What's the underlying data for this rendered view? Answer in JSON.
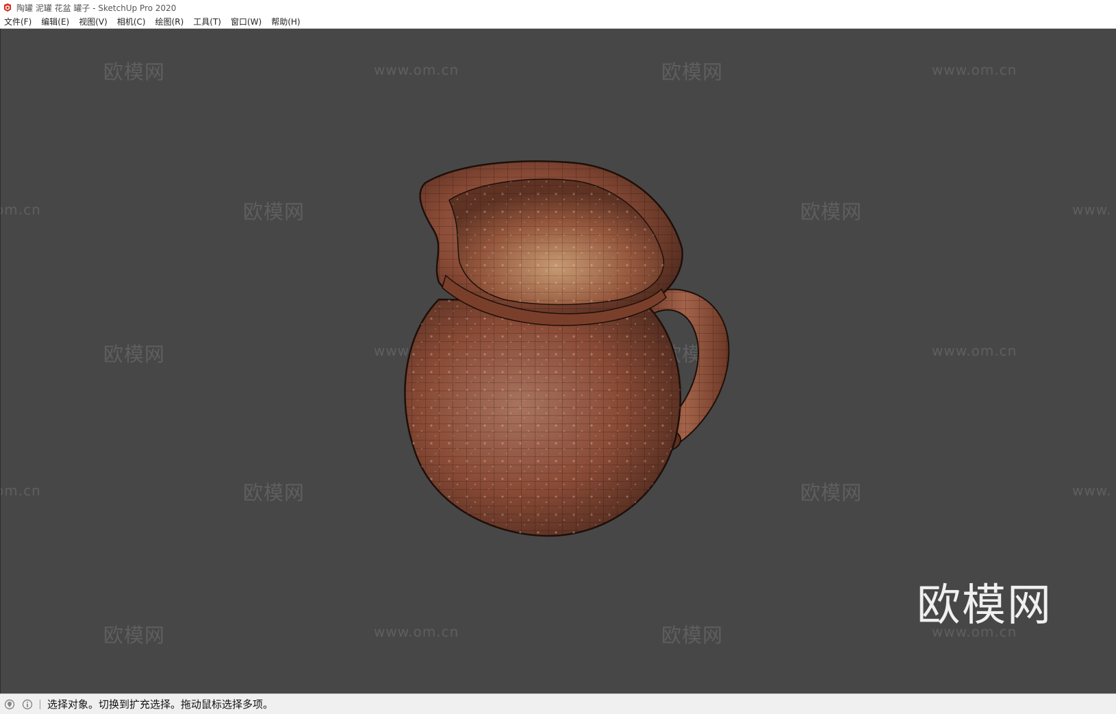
{
  "window": {
    "title": "陶罐 泥罐 花盆 罐子 - SketchUp Pro 2020"
  },
  "menu": {
    "items": [
      {
        "label": "文件(F)"
      },
      {
        "label": "编辑(E)"
      },
      {
        "label": "视图(V)"
      },
      {
        "label": "相机(C)"
      },
      {
        "label": "绘图(R)"
      },
      {
        "label": "工具(T)"
      },
      {
        "label": "窗口(W)"
      },
      {
        "label": "帮助(H)"
      }
    ]
  },
  "viewport": {
    "background_color": "#474747",
    "model_color": "#8a4b36"
  },
  "watermark": {
    "logo_big": "欧模网"
  },
  "status": {
    "message": "选择对象。切换到扩充选择。拖动鼠标选择多项。"
  }
}
